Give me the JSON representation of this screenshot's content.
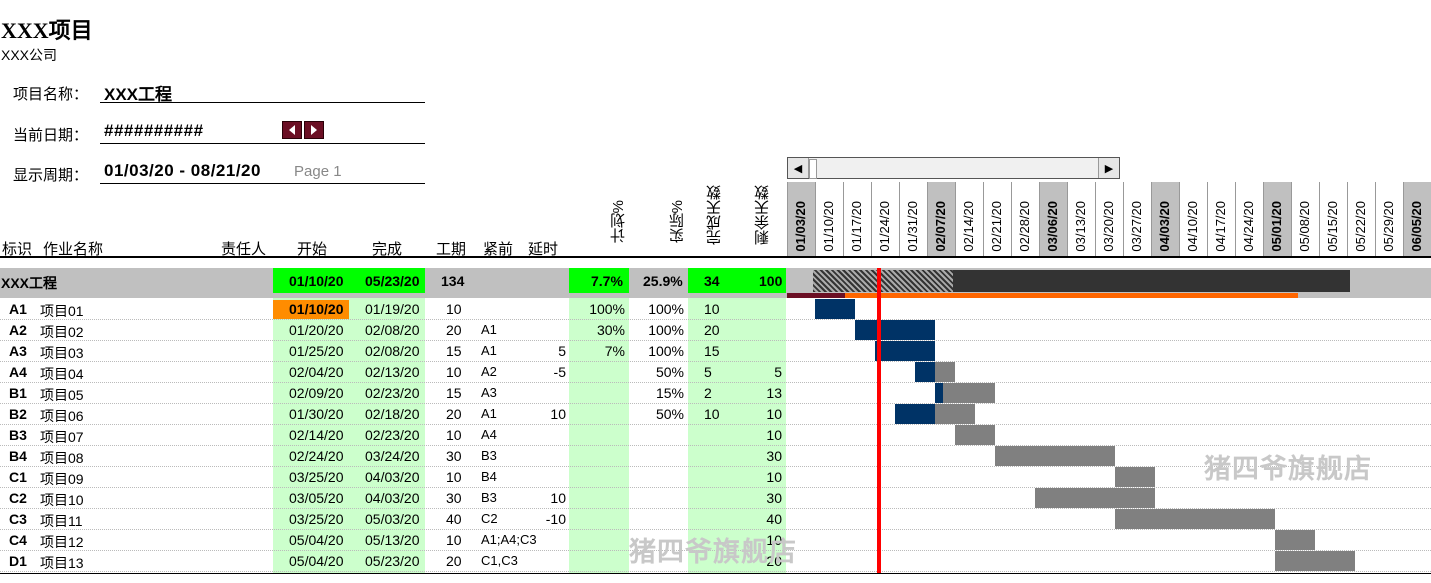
{
  "header": {
    "title": "XXX项目",
    "company": "XXX公司"
  },
  "form": {
    "project_label": "项目名称：",
    "project_value": "XXX工程",
    "date_label": "当前日期：",
    "date_value": "##########",
    "period_label": "显示周期：",
    "period_value": "01/03/20 - 08/21/20",
    "page_label": "Page 1"
  },
  "columns": {
    "id": "标识",
    "name": "作业名称",
    "owner": "责任人",
    "start": "开始",
    "finish": "完成",
    "duration": "工期",
    "pred": "紧前",
    "delay": "延时",
    "plan_pct": "计划%",
    "actual_pct": "实际%",
    "days_done": "完成天数",
    "days_left": "剩余天数"
  },
  "timeline": [
    {
      "label": "01/03/20",
      "bold": true
    },
    {
      "label": "01/10/20",
      "bold": false
    },
    {
      "label": "01/17/20",
      "bold": false
    },
    {
      "label": "01/24/20",
      "bold": false
    },
    {
      "label": "01/31/20",
      "bold": false
    },
    {
      "label": "02/07/20",
      "bold": true
    },
    {
      "label": "02/14/20",
      "bold": false
    },
    {
      "label": "02/21/20",
      "bold": false
    },
    {
      "label": "02/28/20",
      "bold": false
    },
    {
      "label": "03/06/20",
      "bold": true
    },
    {
      "label": "03/13/20",
      "bold": false
    },
    {
      "label": "03/20/20",
      "bold": false
    },
    {
      "label": "03/27/20",
      "bold": false
    },
    {
      "label": "04/03/20",
      "bold": true
    },
    {
      "label": "04/10/20",
      "bold": false
    },
    {
      "label": "04/17/20",
      "bold": false
    },
    {
      "label": "04/24/20",
      "bold": false
    },
    {
      "label": "05/01/20",
      "bold": true
    },
    {
      "label": "05/08/20",
      "bold": false
    },
    {
      "label": "05/15/20",
      "bold": false
    },
    {
      "label": "05/22/20",
      "bold": false
    },
    {
      "label": "05/29/20",
      "bold": false
    },
    {
      "label": "06/05/20",
      "bold": true
    }
  ],
  "summary": {
    "name": "XXX工程",
    "start": "01/10/20",
    "finish": "05/23/20",
    "duration": "134",
    "plan_pct": "7.7%",
    "actual_pct": "25.9%",
    "days_done": "34",
    "days_left": "100"
  },
  "tasks": [
    {
      "id": "A1",
      "name": "项目01",
      "start": "01/10/20",
      "finish": "01/19/20",
      "duration": "10",
      "pred": "",
      "delay": "",
      "plan": "100%",
      "actual": "100%",
      "done": "10",
      "left": ""
    },
    {
      "id": "A2",
      "name": "项目02",
      "start": "01/20/20",
      "finish": "02/08/20",
      "duration": "20",
      "pred": "A1",
      "delay": "",
      "plan": "30%",
      "actual": "100%",
      "done": "20",
      "left": ""
    },
    {
      "id": "A3",
      "name": "项目03",
      "start": "01/25/20",
      "finish": "02/08/20",
      "duration": "15",
      "pred": "A1",
      "delay": "5",
      "plan": "7%",
      "actual": "100%",
      "done": "15",
      "left": ""
    },
    {
      "id": "A4",
      "name": "项目04",
      "start": "02/04/20",
      "finish": "02/13/20",
      "duration": "10",
      "pred": "A2",
      "delay": "-5",
      "plan": "",
      "actual": "50%",
      "done": "5",
      "left": "5"
    },
    {
      "id": "B1",
      "name": "项目05",
      "start": "02/09/20",
      "finish": "02/23/20",
      "duration": "15",
      "pred": "A3",
      "delay": "",
      "plan": "",
      "actual": "15%",
      "done": "2",
      "left": "13"
    },
    {
      "id": "B2",
      "name": "项目06",
      "start": "01/30/20",
      "finish": "02/18/20",
      "duration": "20",
      "pred": "A1",
      "delay": "10",
      "plan": "",
      "actual": "50%",
      "done": "10",
      "left": "10"
    },
    {
      "id": "B3",
      "name": "项目07",
      "start": "02/14/20",
      "finish": "02/23/20",
      "duration": "10",
      "pred": "A4",
      "delay": "",
      "plan": "",
      "actual": "",
      "done": "",
      "left": "10"
    },
    {
      "id": "B4",
      "name": "项目08",
      "start": "02/24/20",
      "finish": "03/24/20",
      "duration": "30",
      "pred": "B3",
      "delay": "",
      "plan": "",
      "actual": "",
      "done": "",
      "left": "30"
    },
    {
      "id": "C1",
      "name": "项目09",
      "start": "03/25/20",
      "finish": "04/03/20",
      "duration": "10",
      "pred": "B4",
      "delay": "",
      "plan": "",
      "actual": "",
      "done": "",
      "left": "10"
    },
    {
      "id": "C2",
      "name": "项目10",
      "start": "03/05/20",
      "finish": "04/03/20",
      "duration": "30",
      "pred": "B3",
      "delay": "10",
      "plan": "",
      "actual": "",
      "done": "",
      "left": "30"
    },
    {
      "id": "C3",
      "name": "项目11",
      "start": "03/25/20",
      "finish": "05/03/20",
      "duration": "40",
      "pred": "C2",
      "delay": "-10",
      "plan": "",
      "actual": "",
      "done": "",
      "left": "40"
    },
    {
      "id": "C4",
      "name": "项目12",
      "start": "05/04/20",
      "finish": "05/13/20",
      "duration": "10",
      "pred": "A1;A4;C3",
      "delay": "",
      "plan": "",
      "actual": "",
      "done": "",
      "left": "10"
    },
    {
      "id": "D1",
      "name": "项目13",
      "start": "05/04/20",
      "finish": "05/23/20",
      "duration": "20",
      "pred": "C1,C3",
      "delay": "",
      "plan": "",
      "actual": "",
      "done": "",
      "left": "20"
    }
  ],
  "watermark": "猪四爷旗舰店",
  "colors": {
    "done": "#003366",
    "remaining": "#808080",
    "today": "#ff0000",
    "plan_col": "#ccffcc",
    "highlight": "#00ff00",
    "current": "#ff8c00"
  }
}
